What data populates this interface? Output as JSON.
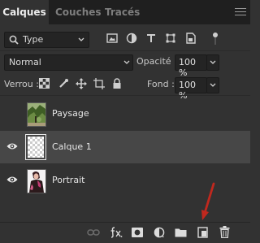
{
  "tabs": [
    {
      "label": "Calques",
      "active": true
    },
    {
      "label": "Couches",
      "active": false
    },
    {
      "label": "Tracés",
      "active": false
    }
  ],
  "filter": {
    "kind_label": "Type",
    "icons": [
      "image-filter-icon",
      "adjustment-filter-icon",
      "type-filter-icon",
      "shape-filter-icon",
      "smart-object-filter-icon",
      "filter-toggle"
    ]
  },
  "blend": {
    "mode": "Normal",
    "opacity_label": "Opacité :",
    "opacity_value": "100 %"
  },
  "lock": {
    "label": "Verrou :",
    "icons": [
      "lock-transparent-pixels-icon",
      "lock-image-pixels-icon",
      "lock-position-icon",
      "lock-artboard-icon",
      "lock-all-icon"
    ],
    "fill_label": "Fond :",
    "fill_value": "100 %"
  },
  "layers": [
    {
      "name": "Paysage",
      "visible": false,
      "selected": false,
      "thumb": "landscape"
    },
    {
      "name": "Calque 1",
      "visible": true,
      "selected": true,
      "thumb": "transparent"
    },
    {
      "name": "Portrait",
      "visible": true,
      "selected": false,
      "thumb": "portrait"
    }
  ],
  "bottom_icons": [
    "link-layers-icon",
    "fx-icon",
    "add-mask-icon",
    "adjustment-layer-icon",
    "new-group-icon",
    "new-layer-icon",
    "delete-layer-icon"
  ],
  "colors": {
    "panel": "#323232",
    "tab_bar": "#1f1f1f",
    "selected_row": "#474747",
    "arrow": "#c0281e"
  }
}
